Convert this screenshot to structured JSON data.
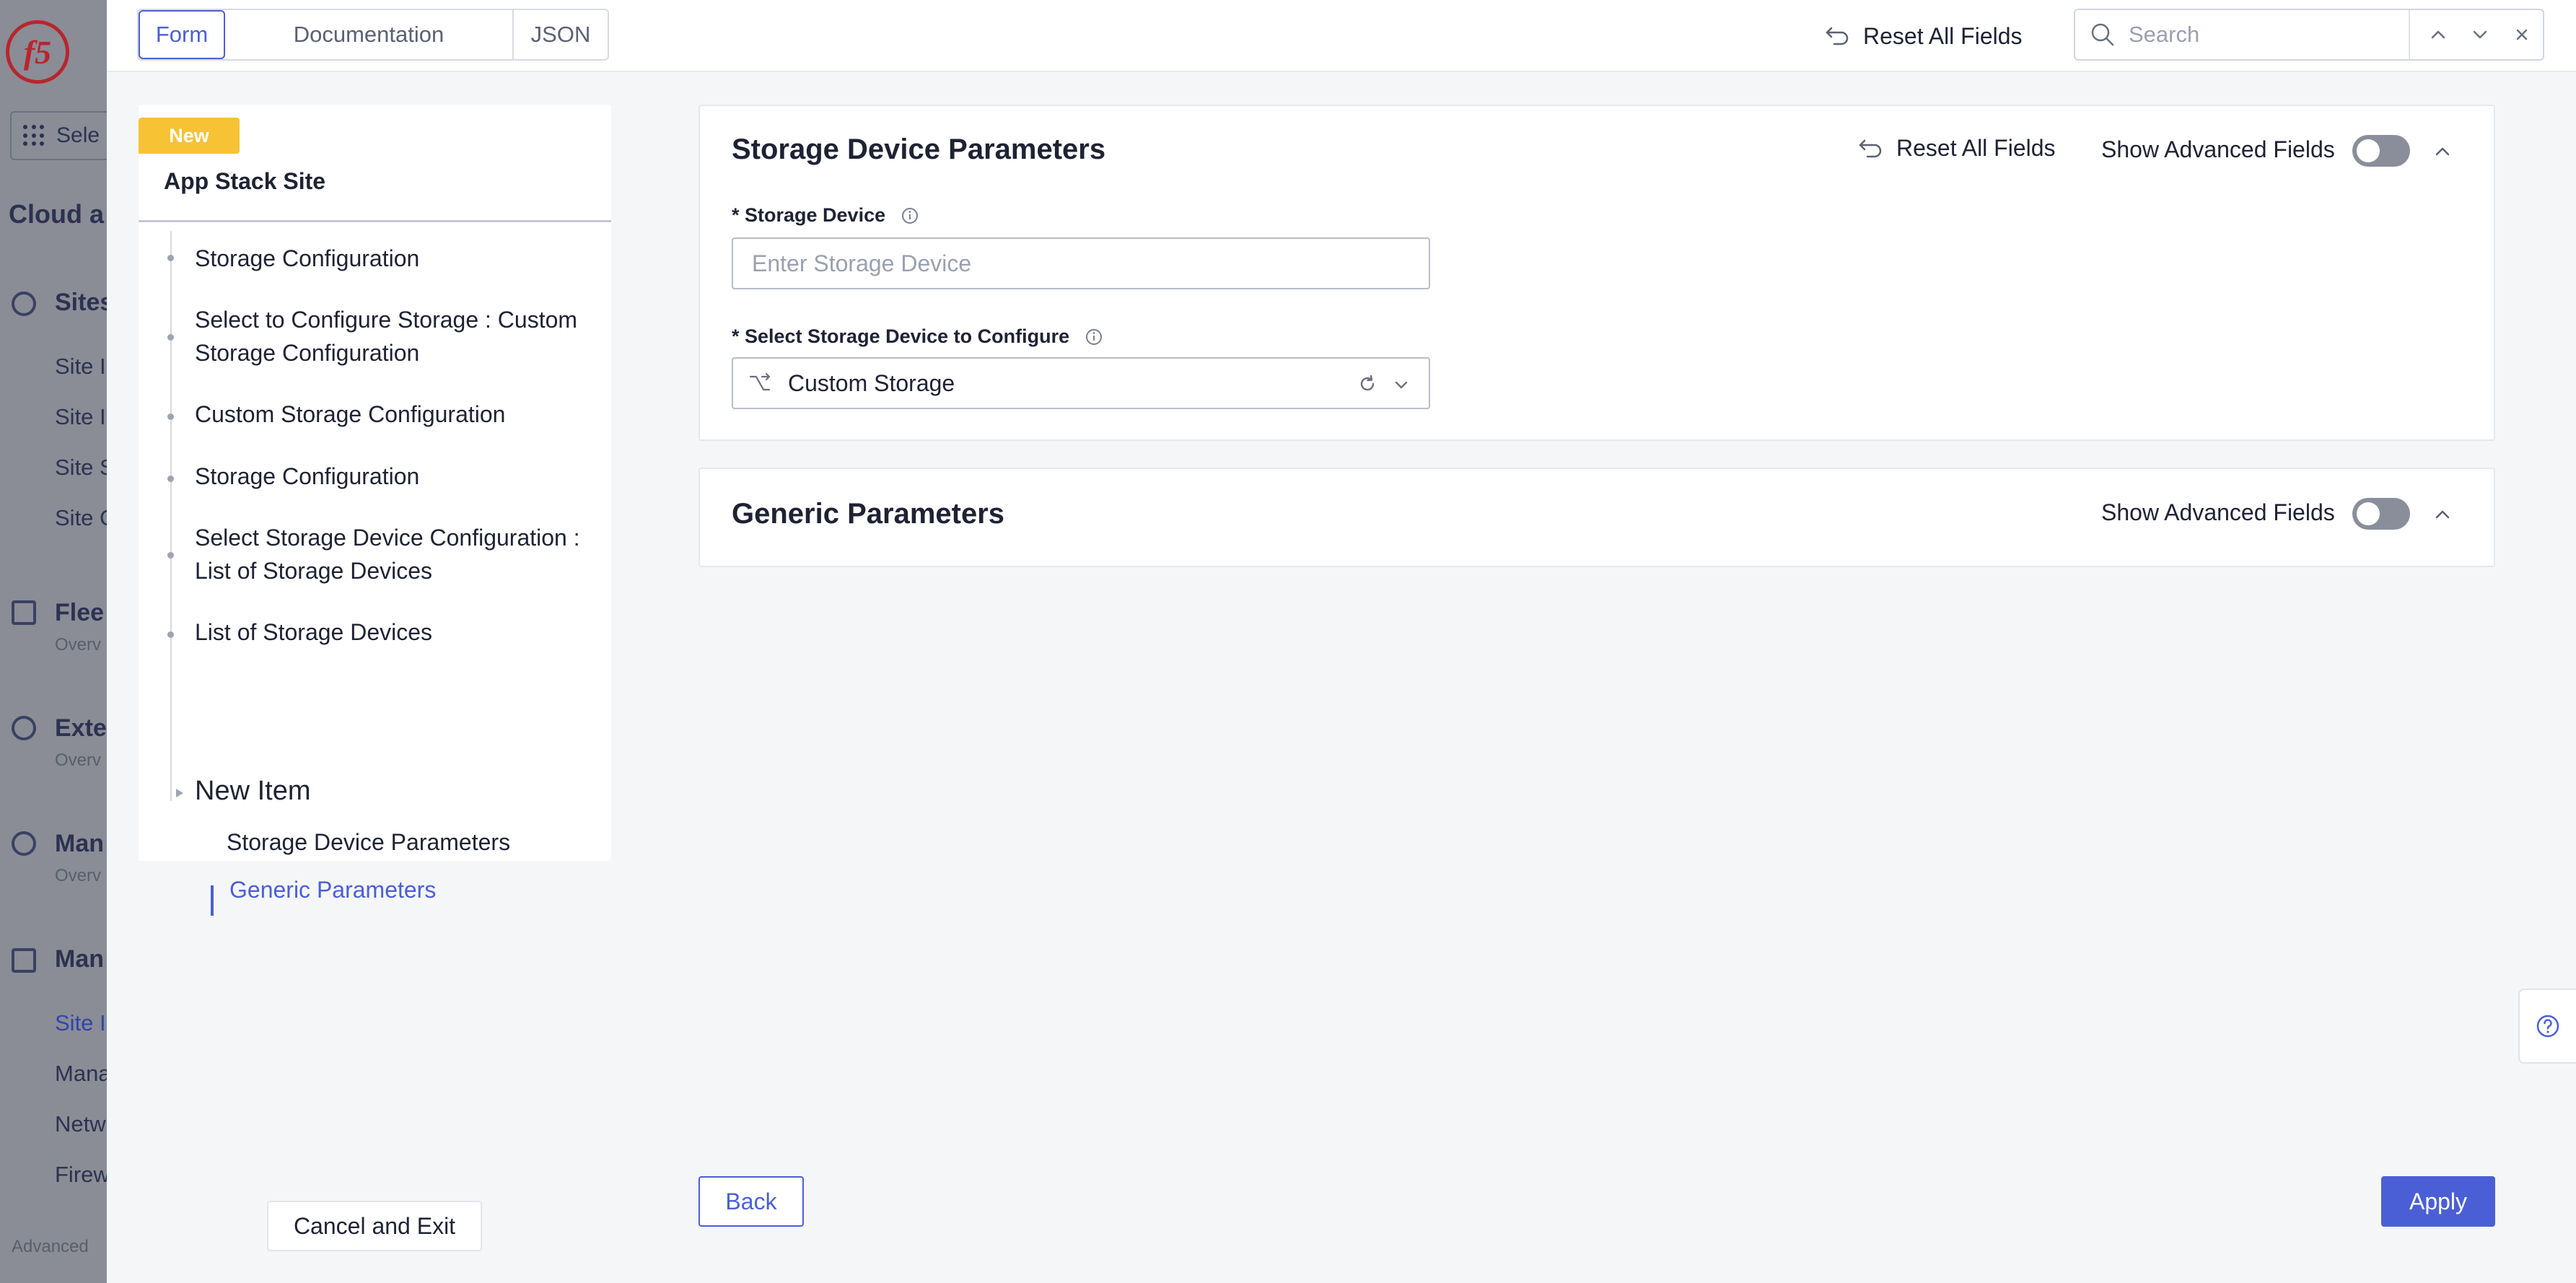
{
  "background_sidebar": {
    "select_label": "Sele",
    "section_head": "Cloud a",
    "sites": {
      "label": "Sites",
      "items": [
        "Site I",
        "Site I",
        "Site S",
        "Site C"
      ]
    },
    "fleet": {
      "label": "Flee",
      "sub": "Overv"
    },
    "exte": {
      "label": "Exte",
      "sub": "Overv"
    },
    "man1": {
      "label": "Man",
      "sub": "Overv"
    },
    "man2": {
      "label": "Man",
      "items": [
        "Site I",
        "Mana",
        "Netw",
        "Firew"
      ]
    },
    "advanced": "Advanced"
  },
  "toolbar": {
    "tabs": [
      "Form",
      "Documentation",
      "JSON"
    ],
    "active_tab": "Form",
    "reset_all": "Reset All Fields",
    "search_placeholder": "Search"
  },
  "tree": {
    "badge": "New",
    "title": "App Stack Site",
    "items": [
      "Storage Configuration",
      "Select to Configure Storage : Custom Storage Configuration",
      "Custom Storage Configuration",
      "Storage Configuration",
      "Select Storage Device Configuration : List of Storage Devices",
      "List of Storage Devices"
    ],
    "new_item": "New Item",
    "sub_items": [
      "Storage Device Parameters",
      "Generic Parameters"
    ],
    "active_sub": "Generic Parameters",
    "cancel": "Cancel and Exit"
  },
  "storage_card": {
    "title": "Storage Device Parameters",
    "reset": "Reset All Fields",
    "advanced": "Show Advanced Fields",
    "advanced_enabled": false,
    "device_label": "* Storage Device",
    "device_placeholder": "Enter Storage Device",
    "device_value": "",
    "select_label": "* Select Storage Device to Configure",
    "select_value": "Custom Storage"
  },
  "generic_card": {
    "title": "Generic Parameters",
    "advanced": "Show Advanced Fields",
    "advanced_enabled": false
  },
  "footer": {
    "back": "Back",
    "apply": "Apply"
  },
  "colors": {
    "accent": "#4a5fd6",
    "badge": "#f7c234",
    "brand": "#b7262e"
  }
}
